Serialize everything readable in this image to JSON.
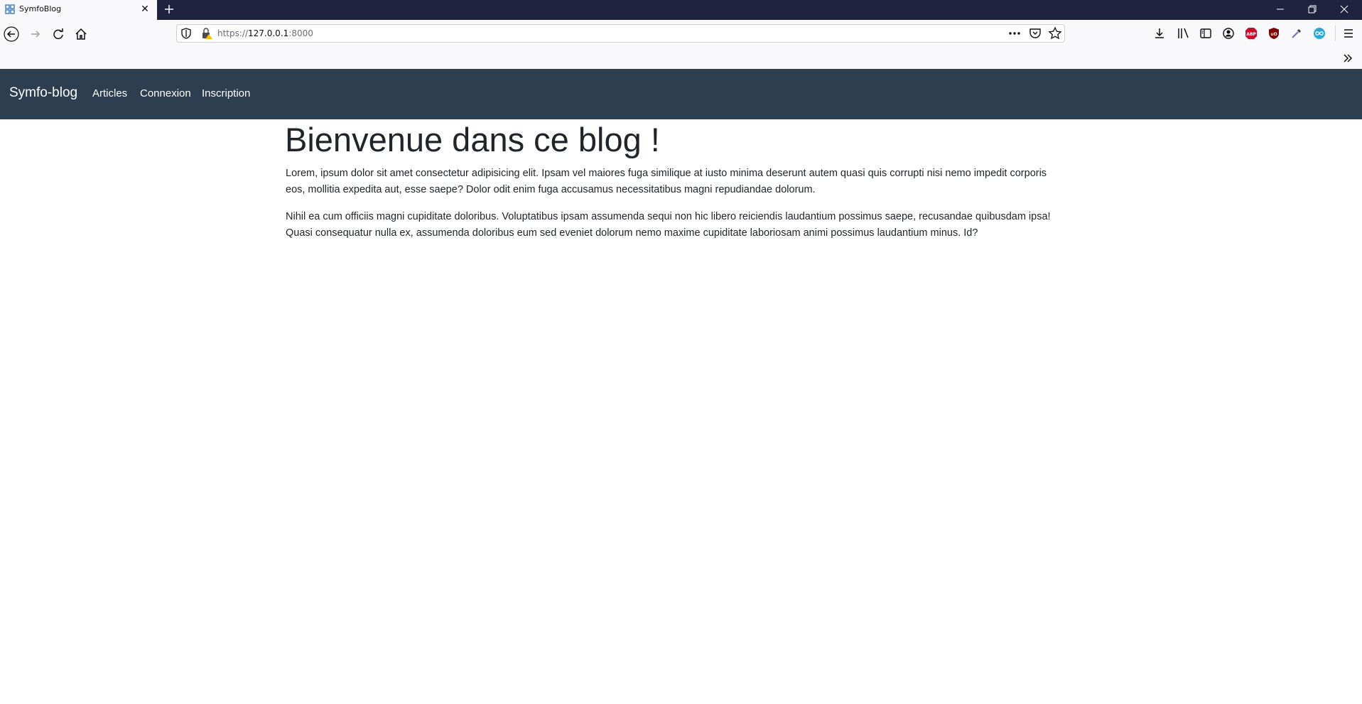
{
  "browser": {
    "tab": {
      "title": "SymfoBlog"
    },
    "url": {
      "scheme": "https://",
      "host": "127.0.0.1",
      "port": ":8000"
    }
  },
  "site": {
    "brand": "Symfo-blog",
    "nav": [
      {
        "label": "Articles"
      },
      {
        "label": "Connexion"
      },
      {
        "label": "Inscription"
      }
    ]
  },
  "main": {
    "title": "Bienvenue dans ce blog !",
    "paragraphs": [
      "Lorem, ipsum dolor sit amet consectetur adipisicing elit. Ipsam vel maiores fuga similique at iusto minima deserunt autem quasi quis corrupti nisi nemo impedit corporis eos, mollitia expedita aut, esse saepe? Dolor odit enim fuga accusamus necessitatibus magni repudiandae dolorum.",
      "Nihil ea cum officiis magni cupiditate doloribus. Voluptatibus ipsam assumenda sequi non hic libero reiciendis laudantium possimus saepe, recusandae quibusdam ipsa! Quasi consequatur nulla ex, assumenda doloribus eum sed eveniet dolorum nemo maxime cupiditate laboriosam animi possimus laudantium minus. Id?"
    ]
  },
  "colors": {
    "tabstrip": "#202340",
    "site_nav": "#2c3e50",
    "text": "#212529"
  }
}
